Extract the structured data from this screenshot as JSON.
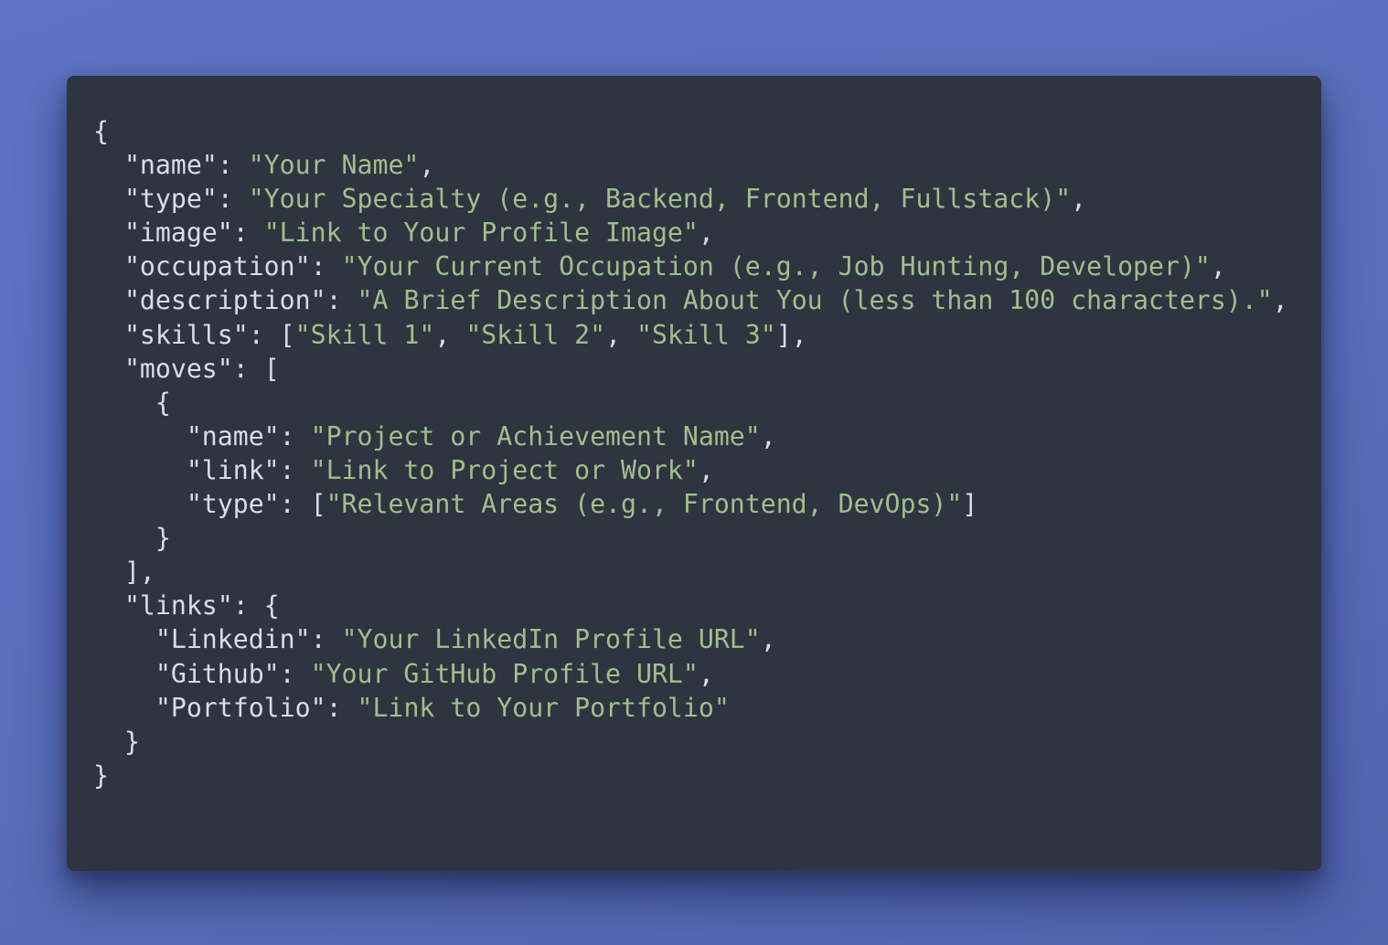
{
  "code": {
    "keys": {
      "name": "\"name\"",
      "type": "\"type\"",
      "image": "\"image\"",
      "occupation": "\"occupation\"",
      "description": "\"description\"",
      "skills": "\"skills\"",
      "moves": "\"moves\"",
      "move_name": "\"name\"",
      "move_link": "\"link\"",
      "move_type": "\"type\"",
      "links": "\"links\"",
      "linkedin": "\"Linkedin\"",
      "github": "\"Github\"",
      "portfolio": "\"Portfolio\""
    },
    "values": {
      "name": "\"Your Name\"",
      "type": "\"Your Specialty (e.g., Backend, Frontend, Fullstack)\"",
      "image": "\"Link to Your Profile Image\"",
      "occupation": "\"Your Current Occupation (e.g., Job Hunting, Developer)\"",
      "description": "\"A Brief Description About You (less than 100 characters).\"",
      "skills": [
        "\"Skill 1\"",
        "\"Skill 2\"",
        "\"Skill 3\""
      ],
      "move_name": "\"Project or Achievement Name\"",
      "move_link": "\"Link to Project or Work\"",
      "move_type": "\"Relevant Areas (e.g., Frontend, DevOps)\"",
      "linkedin": "\"Your LinkedIn Profile URL\"",
      "github": "\"Your GitHub Profile URL\"",
      "portfolio": "\"Link to Your Portfolio\""
    },
    "colors": {
      "background": "#2e3440",
      "text": "#d8dee9",
      "string": "#a3be8c"
    }
  }
}
